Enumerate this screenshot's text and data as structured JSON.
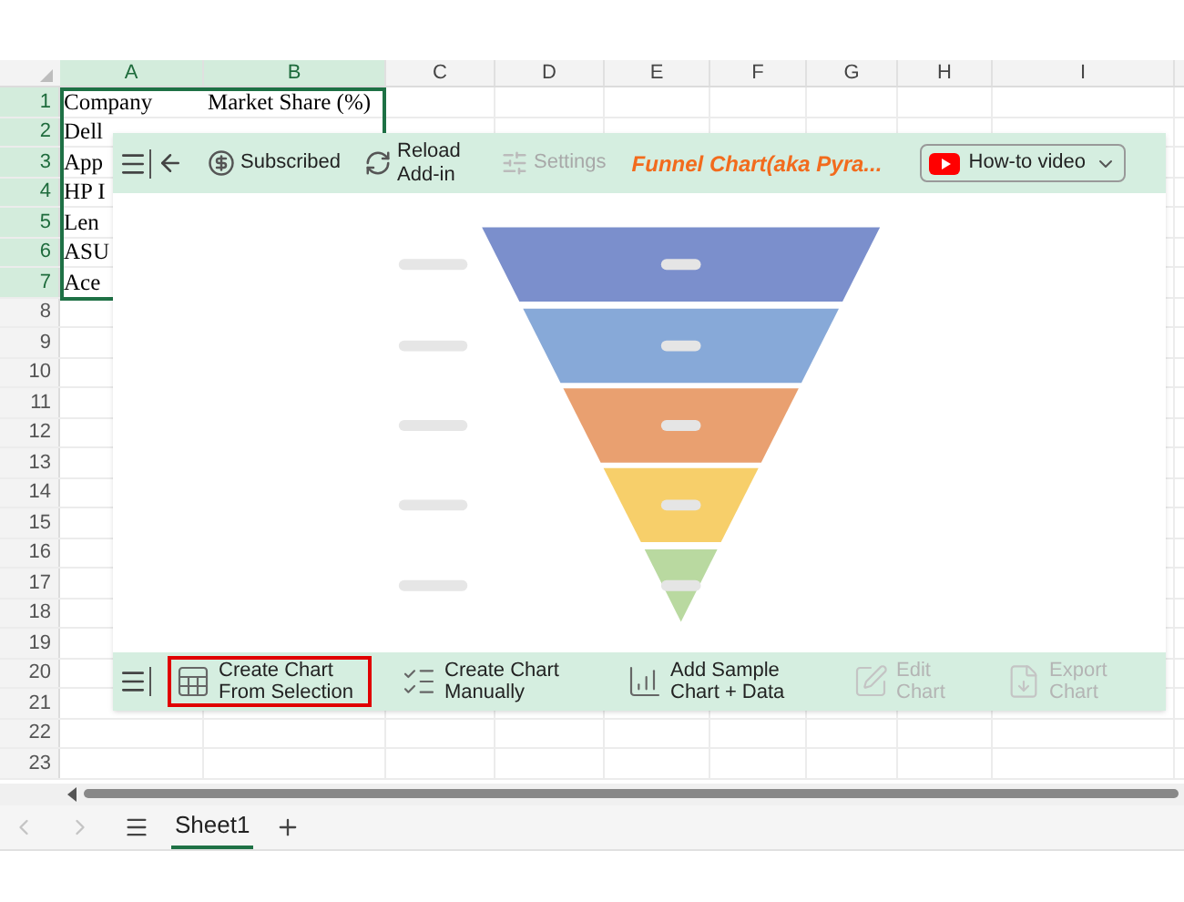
{
  "sheet": {
    "columns": [
      {
        "label": "A",
        "selected": true
      },
      {
        "label": "B",
        "selected": true
      },
      {
        "label": "C",
        "selected": false
      },
      {
        "label": "D",
        "selected": false
      },
      {
        "label": "E",
        "selected": false
      },
      {
        "label": "F",
        "selected": false
      },
      {
        "label": "G",
        "selected": false
      },
      {
        "label": "H",
        "selected": false
      },
      {
        "label": "I",
        "selected": false
      }
    ],
    "rows": [
      {
        "label": "1",
        "selected": true,
        "cells": [
          "Company",
          "Market Share (%)"
        ]
      },
      {
        "label": "2",
        "selected": true,
        "cells": [
          "Dell"
        ]
      },
      {
        "label": "3",
        "selected": true,
        "cells": [
          "App"
        ]
      },
      {
        "label": "4",
        "selected": true,
        "cells": [
          "HP I"
        ]
      },
      {
        "label": "5",
        "selected": true,
        "cells": [
          "Len"
        ]
      },
      {
        "label": "6",
        "selected": true,
        "cells": [
          "ASU"
        ]
      },
      {
        "label": "7",
        "selected": true,
        "cells": [
          "Ace"
        ]
      },
      {
        "label": "8",
        "selected": false,
        "cells": []
      },
      {
        "label": "9",
        "selected": false,
        "cells": []
      },
      {
        "label": "10",
        "selected": false,
        "cells": []
      },
      {
        "label": "11",
        "selected": false,
        "cells": []
      },
      {
        "label": "12",
        "selected": false,
        "cells": []
      },
      {
        "label": "13",
        "selected": false,
        "cells": []
      },
      {
        "label": "14",
        "selected": false,
        "cells": []
      },
      {
        "label": "15",
        "selected": false,
        "cells": []
      },
      {
        "label": "16",
        "selected": false,
        "cells": []
      },
      {
        "label": "17",
        "selected": false,
        "cells": []
      },
      {
        "label": "18",
        "selected": false,
        "cells": []
      },
      {
        "label": "19",
        "selected": false,
        "cells": []
      },
      {
        "label": "20",
        "selected": false,
        "cells": []
      },
      {
        "label": "21",
        "selected": false,
        "cells": []
      },
      {
        "label": "22",
        "selected": false,
        "cells": []
      },
      {
        "label": "23",
        "selected": false,
        "cells": []
      }
    ]
  },
  "addin": {
    "toolbar": [
      {
        "kind": "subscribed",
        "label": "Subscribed",
        "disabled": false
      },
      {
        "kind": "reload",
        "label": "Reload Add-in",
        "disabled": false
      },
      {
        "kind": "settings",
        "label": "Settings",
        "disabled": true
      }
    ],
    "title": "Funnel Chart(aka Pyra...",
    "video_button": "How-to video",
    "actions": [
      {
        "kind": "selection",
        "label": "Create Chart From Selection",
        "selected": true,
        "disabled": false
      },
      {
        "kind": "manual",
        "label": "Create Chart Manually",
        "selected": false,
        "disabled": false
      },
      {
        "kind": "sample",
        "label": "Add Sample Chart + Data",
        "selected": false,
        "disabled": false
      },
      {
        "kind": "edit",
        "label": "Edit Chart",
        "selected": false,
        "disabled": true
      },
      {
        "kind": "export",
        "label": "Export Chart",
        "selected": false,
        "disabled": true
      }
    ]
  },
  "sheet_tabs": [
    {
      "label": "Sheet1",
      "selected": true
    }
  ]
}
